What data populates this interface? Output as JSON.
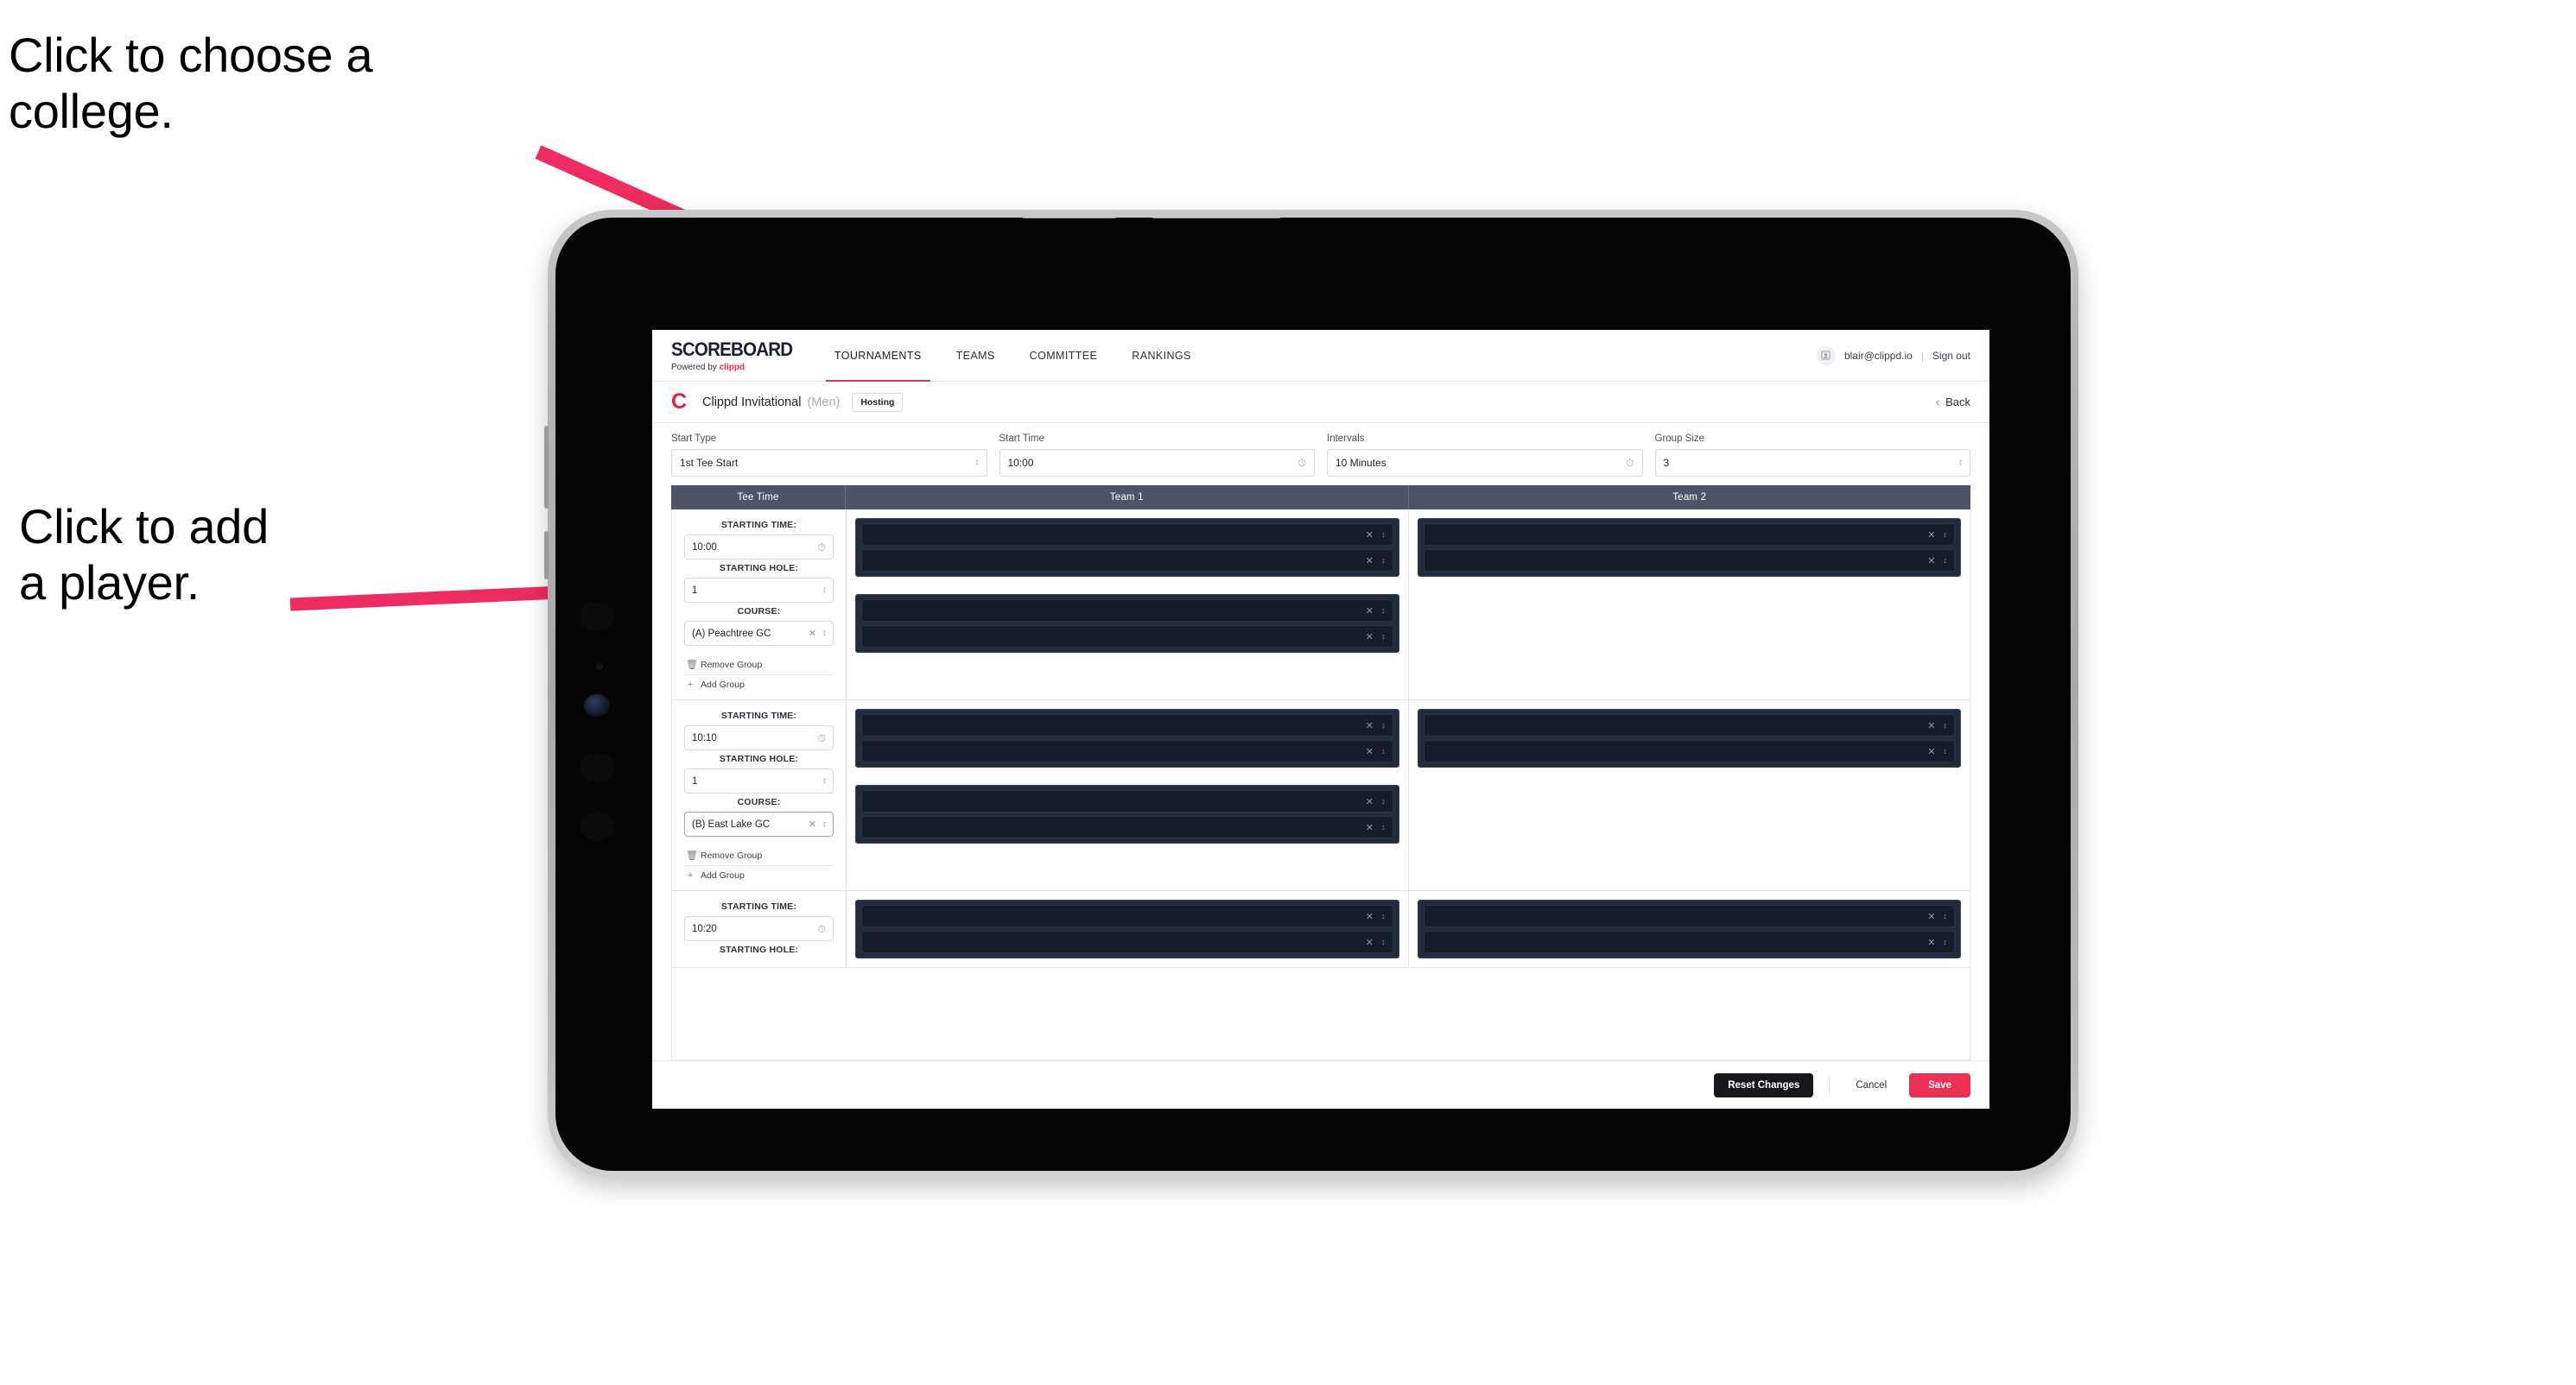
{
  "annotations": {
    "choose_college": "Click to choose a\ncollege.",
    "add_player": "Click to add\na player."
  },
  "colors": {
    "accent_pink": "#eb3054",
    "arrow_pink": "#ED2D61",
    "table_header": "#4d5467",
    "player_box_outer": "#232c3d",
    "player_box_inner": "#151c2a"
  },
  "app": {
    "brand": {
      "title": "SCOREBOARD",
      "powered_prefix": "Powered by",
      "powered_brand": "clippd"
    },
    "nav": [
      {
        "label": "TOURNAMENTS",
        "active": true
      },
      {
        "label": "TEAMS",
        "active": false
      },
      {
        "label": "COMMITTEE",
        "active": false
      },
      {
        "label": "RANKINGS",
        "active": false
      }
    ],
    "user": {
      "avatar_icon": "user-avatar-icon",
      "email": "blair@clippd.io",
      "separator": "|",
      "sign_out": "Sign out"
    },
    "event": {
      "logo_letter": "C",
      "name": "Clippd Invitational",
      "gender": "(Men)",
      "badge": "Hosting",
      "back_chevron": "‹",
      "back_label": "Back"
    },
    "controls": [
      {
        "label": "Start Type",
        "value": "1st Tee Start",
        "icon": "stepper-icon"
      },
      {
        "label": "Start Time",
        "value": "10:00",
        "icon": "clock-icon"
      },
      {
        "label": "Intervals",
        "value": "10 Minutes",
        "icon": "clock-icon"
      },
      {
        "label": "Group Size",
        "value": "3",
        "icon": "stepper-icon"
      }
    ],
    "table": {
      "headers": [
        "Tee Time",
        "Team 1",
        "Team 2"
      ],
      "field_labels": {
        "starting_time": "STARTING TIME:",
        "starting_hole": "STARTING HOLE:",
        "course": "COURSE:"
      },
      "group_actions": {
        "remove": "Remove Group",
        "remove_icon": "trash-icon",
        "add": "Add Group",
        "add_icon": "plus-icon"
      },
      "rows": [
        {
          "starting_time": "10:00",
          "starting_hole": "1",
          "course": "(A) Peachtree GC",
          "course_focused": false,
          "team1_groups": [
            2,
            2
          ],
          "team2_groups": [
            2
          ]
        },
        {
          "starting_time": "10:10",
          "starting_hole": "1",
          "course": "(B) East Lake GC",
          "course_focused": true,
          "team1_groups": [
            2,
            2
          ],
          "team2_groups": [
            2
          ]
        },
        {
          "starting_time": "10:20",
          "starting_hole": "",
          "course": "",
          "course_focused": false,
          "team1_groups": [
            2
          ],
          "team2_groups": [
            2
          ]
        }
      ],
      "row_icons": {
        "clear": "close-x-icon",
        "stepper": "stepper-icon"
      }
    },
    "footer": {
      "reset": "Reset Changes",
      "cancel": "Cancel",
      "save": "Save"
    }
  }
}
